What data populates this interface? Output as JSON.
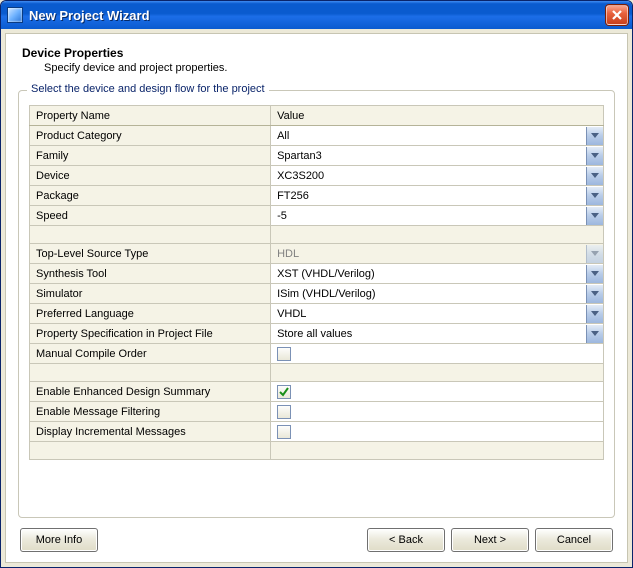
{
  "window": {
    "title": "New Project Wizard"
  },
  "heading": {
    "title": "Device Properties",
    "subtitle": "Specify device and project properties."
  },
  "group": {
    "legend": "Select the device and design flow for the project"
  },
  "table": {
    "header_name": "Property Name",
    "header_value": "Value",
    "rows_a": [
      {
        "label": "Product Category",
        "value": "All",
        "dropdown": true
      },
      {
        "label": "Family",
        "value": "Spartan3",
        "dropdown": true
      },
      {
        "label": "Device",
        "value": "XC3S200",
        "dropdown": true
      },
      {
        "label": "Package",
        "value": "FT256",
        "dropdown": true
      },
      {
        "label": "Speed",
        "value": "-5",
        "dropdown": true
      }
    ],
    "rows_b": [
      {
        "label": "Top-Level Source Type",
        "value": "HDL",
        "dropdown": true,
        "readonly": true
      },
      {
        "label": "Synthesis Tool",
        "value": "XST (VHDL/Verilog)",
        "dropdown": true
      },
      {
        "label": "Simulator",
        "value": "ISim (VHDL/Verilog)",
        "dropdown": true
      },
      {
        "label": "Preferred Language",
        "value": "VHDL",
        "dropdown": true
      },
      {
        "label": "Property Specification in Project File",
        "value": "Store all values",
        "dropdown": true
      },
      {
        "label": "Manual Compile Order",
        "checkbox": true,
        "checked": false
      }
    ],
    "rows_c": [
      {
        "label": "Enable Enhanced Design Summary",
        "checkbox": true,
        "checked": true
      },
      {
        "label": "Enable Message Filtering",
        "checkbox": true,
        "checked": false
      },
      {
        "label": "Display Incremental Messages",
        "checkbox": true,
        "checked": false
      }
    ]
  },
  "buttons": {
    "more_info": "More Info",
    "back": "< Back",
    "next": "Next >",
    "cancel": "Cancel"
  }
}
